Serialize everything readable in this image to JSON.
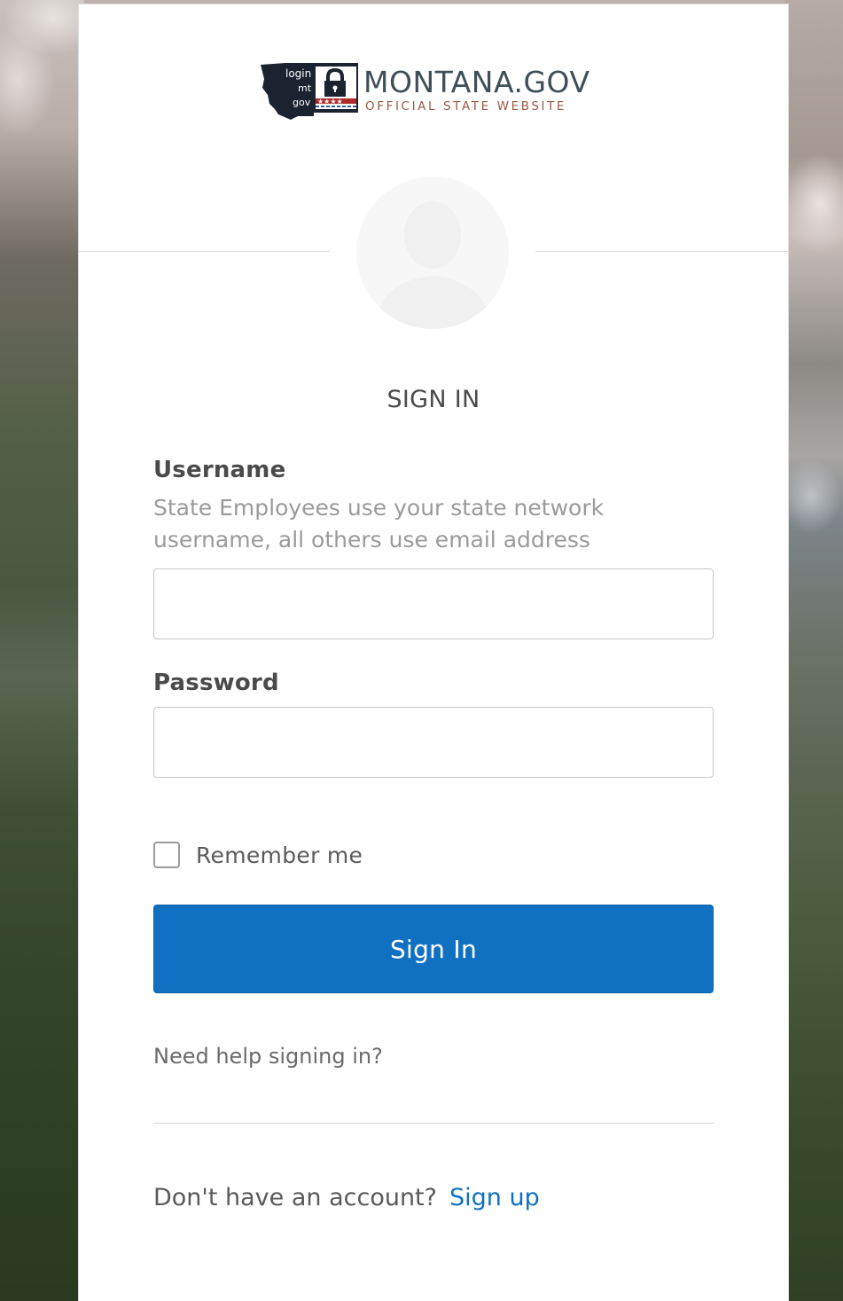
{
  "logo": {
    "badge_lines": [
      "login",
      "mt",
      "gov"
    ],
    "title": "MONTANA.GOV",
    "subtitle": "OFFICIAL STATE WEBSITE"
  },
  "heading": "SIGN IN",
  "username": {
    "label": "Username",
    "hint_line1": "State Employees use your state network",
    "hint_line2": "username, all others use email address",
    "value": ""
  },
  "password": {
    "label": "Password",
    "value": ""
  },
  "remember": {
    "label": "Remember me",
    "checked": false
  },
  "sign_in_button": "Sign In",
  "help_link": "Need help signing in?",
  "signup": {
    "prompt": "Don't have an account?",
    "link": "Sign up"
  },
  "colors": {
    "primary": "#1071c2",
    "logo_title": "#3f4f57",
    "logo_subtitle": "#9a5a45"
  },
  "icons": [
    "montana-map-logo-icon",
    "lock-icon",
    "user-avatar-icon"
  ]
}
